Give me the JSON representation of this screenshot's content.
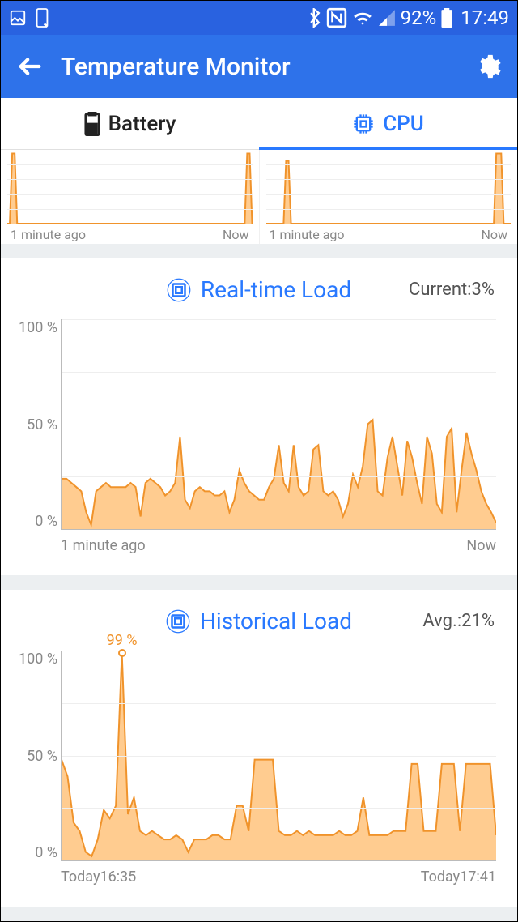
{
  "status_bar": {
    "battery_pct": "92%",
    "time": "17:49"
  },
  "app_bar": {
    "title": "Temperature Monitor"
  },
  "tabs": {
    "battery": "Battery",
    "cpu": "CPU",
    "active": "cpu"
  },
  "mini": {
    "x_start": "1 minute ago",
    "x_end": "Now"
  },
  "realtime": {
    "title": "Real-time Load",
    "stat_label": "Current:",
    "stat_value": "3%",
    "y_top": "100 %",
    "y_mid": "50 %",
    "y_bot": "0 %",
    "x_start": "1 minute ago",
    "x_end": "Now"
  },
  "historical": {
    "title": "Historical Load",
    "stat_label": "Avg.:",
    "stat_value": "21%",
    "y_top": "100 %",
    "y_mid": "50 %",
    "y_bot": "0 %",
    "x_start": "Today16:35",
    "x_end": "Today17:41",
    "annotation": "99 %"
  },
  "chart_data": [
    {
      "type": "area",
      "name": "mini-left",
      "ylim": [
        0,
        100
      ],
      "xlabel_start": "1 minute ago",
      "xlabel_end": "Now",
      "values": [
        0,
        0,
        95,
        95,
        0,
        0,
        0,
        0,
        0,
        0,
        0,
        0,
        0,
        0,
        0,
        0,
        0,
        0,
        0,
        0,
        0,
        0,
        0,
        0,
        0,
        0,
        0,
        0,
        0,
        0,
        0,
        0,
        0,
        0,
        0,
        0,
        0,
        0,
        0,
        0,
        0,
        0,
        0,
        0,
        0,
        0,
        0,
        0,
        0,
        0,
        0,
        0,
        0,
        0,
        0,
        0,
        0,
        0,
        0,
        0,
        0,
        0,
        0,
        0,
        0,
        0,
        0,
        0,
        0,
        0,
        0,
        0,
        0,
        0,
        0,
        0,
        0,
        0,
        0,
        0,
        0,
        0,
        0,
        0,
        0,
        0,
        0,
        0,
        0,
        0,
        0,
        0,
        0,
        0,
        0,
        0,
        0,
        95,
        95,
        0
      ]
    },
    {
      "type": "area",
      "name": "mini-right",
      "ylim": [
        0,
        100
      ],
      "xlabel_start": "1 minute ago",
      "xlabel_end": "Now",
      "values": [
        0,
        0,
        0,
        0,
        0,
        0,
        0,
        0,
        85,
        85,
        0,
        0,
        0,
        0,
        0,
        0,
        0,
        0,
        0,
        0,
        0,
        0,
        0,
        0,
        0,
        0,
        0,
        0,
        0,
        0,
        0,
        0,
        0,
        0,
        0,
        0,
        0,
        0,
        0,
        0,
        0,
        0,
        0,
        0,
        0,
        0,
        0,
        0,
        0,
        0,
        0,
        0,
        0,
        0,
        0,
        0,
        0,
        0,
        0,
        0,
        0,
        0,
        0,
        0,
        0,
        0,
        0,
        0,
        0,
        0,
        0,
        0,
        0,
        0,
        0,
        0,
        0,
        0,
        0,
        0,
        0,
        0,
        0,
        0,
        0,
        0,
        0,
        0,
        0,
        0,
        0,
        0,
        0,
        95,
        95,
        95,
        0,
        0,
        0,
        0
      ]
    },
    {
      "type": "area",
      "name": "realtime-load",
      "title": "Real-time Load",
      "ylabel": "%",
      "ylim": [
        0,
        100
      ],
      "xlabel_start": "1 minute ago",
      "xlabel_end": "Now",
      "current": 3,
      "values": [
        24,
        24,
        22,
        20,
        18,
        8,
        2,
        18,
        20,
        22,
        20,
        20,
        20,
        20,
        22,
        20,
        6,
        22,
        24,
        22,
        20,
        16,
        18,
        22,
        44,
        14,
        10,
        18,
        20,
        18,
        18,
        16,
        16,
        18,
        8,
        14,
        28,
        22,
        18,
        16,
        14,
        14,
        20,
        24,
        40,
        22,
        18,
        40,
        20,
        16,
        18,
        38,
        40,
        18,
        16,
        18,
        14,
        6,
        12,
        26,
        20,
        30,
        50,
        52,
        18,
        16,
        34,
        44,
        30,
        16,
        42,
        34,
        22,
        12,
        44,
        36,
        12,
        8,
        44,
        48,
        8,
        28,
        46,
        36,
        28,
        18,
        12,
        8,
        3
      ]
    },
    {
      "type": "area",
      "name": "historical-load",
      "title": "Historical Load",
      "ylabel": "%",
      "ylim": [
        0,
        100
      ],
      "xlabel_start": "Today16:35",
      "xlabel_end": "Today17:41",
      "avg": 21,
      "annotation": {
        "index": 10,
        "value": 99,
        "label": "99 %"
      },
      "values": [
        48,
        40,
        18,
        14,
        4,
        2,
        10,
        24,
        20,
        26,
        99,
        22,
        30,
        14,
        12,
        14,
        12,
        10,
        10,
        12,
        10,
        4,
        10,
        10,
        10,
        12,
        12,
        10,
        10,
        26,
        26,
        14,
        48,
        48,
        48,
        48,
        14,
        12,
        12,
        14,
        12,
        14,
        12,
        12,
        12,
        12,
        14,
        12,
        12,
        14,
        30,
        12,
        12,
        12,
        12,
        14,
        14,
        14,
        46,
        46,
        14,
        14,
        14,
        46,
        46,
        46,
        14,
        46,
        46,
        46,
        46,
        46,
        12
      ]
    }
  ]
}
